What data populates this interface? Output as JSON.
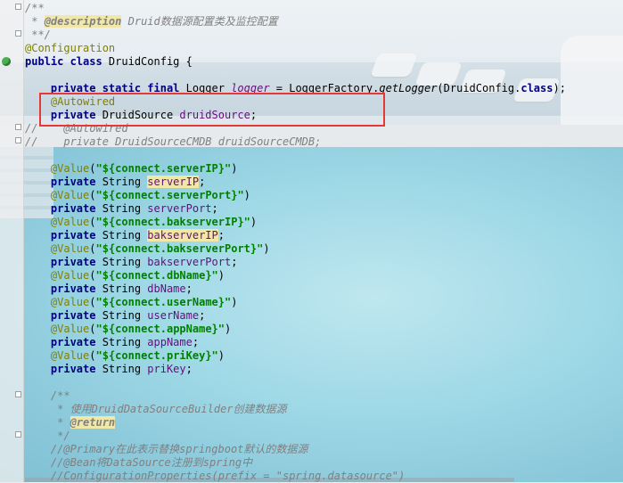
{
  "editor": {
    "lines": [
      [
        {
          "t": "/**",
          "c": "cmt"
        }
      ],
      [
        {
          "t": " * ",
          "c": "cmt"
        },
        {
          "t": "@description",
          "c": "doctag hl"
        },
        {
          "t": " Druid数据源配置类及监控配置",
          "c": "cmt"
        }
      ],
      [
        {
          "t": " **/",
          "c": "cmt"
        }
      ],
      [
        {
          "t": "@Configuration",
          "c": "ann"
        }
      ],
      [
        {
          "t": "public class ",
          "c": "kw"
        },
        {
          "t": "DruidConfig {",
          "c": ""
        }
      ],
      [
        {
          "t": "",
          "c": ""
        }
      ],
      [
        {
          "t": "    "
        },
        {
          "t": "private static final ",
          "c": "kw"
        },
        {
          "t": "Logger ",
          "c": ""
        },
        {
          "t": "logger",
          "c": "fld ital"
        },
        {
          "t": " = LoggerFactory.",
          "c": ""
        },
        {
          "t": "getLogger",
          "c": "ital"
        },
        {
          "t": "(DruidConfig.",
          "c": ""
        },
        {
          "t": "class",
          "c": "kw"
        },
        {
          "t": ");",
          "c": ""
        }
      ],
      [
        {
          "t": "    "
        },
        {
          "t": "@Autowired",
          "c": "ann"
        }
      ],
      [
        {
          "t": "    "
        },
        {
          "t": "private ",
          "c": "kw"
        },
        {
          "t": "DruidSource ",
          "c": ""
        },
        {
          "t": "druidSource",
          "c": "fld"
        },
        {
          "t": ";",
          "c": ""
        }
      ],
      [
        {
          "t": "//    @Autowired",
          "c": "cmt"
        }
      ],
      [
        {
          "t": "//    private DruidSourceCMDB druidSourceCMDB;",
          "c": "cmt"
        }
      ],
      [
        {
          "t": "",
          "c": ""
        }
      ],
      [
        {
          "t": "    "
        },
        {
          "t": "@Value",
          "c": "ann"
        },
        {
          "t": "(",
          "c": ""
        },
        {
          "t": "\"${connect.serverIP}\"",
          "c": "str"
        },
        {
          "t": ")",
          "c": ""
        }
      ],
      [
        {
          "t": "    "
        },
        {
          "t": "private ",
          "c": "kw"
        },
        {
          "t": "String ",
          "c": ""
        },
        {
          "t": "serverIP",
          "c": "fld hl"
        },
        {
          "t": ";",
          "c": ""
        }
      ],
      [
        {
          "t": "    "
        },
        {
          "t": "@Value",
          "c": "ann"
        },
        {
          "t": "(",
          "c": ""
        },
        {
          "t": "\"${connect.serverPort}\"",
          "c": "str"
        },
        {
          "t": ")",
          "c": ""
        }
      ],
      [
        {
          "t": "    "
        },
        {
          "t": "private ",
          "c": "kw"
        },
        {
          "t": "String ",
          "c": ""
        },
        {
          "t": "serverPort",
          "c": "fld"
        },
        {
          "t": ";",
          "c": ""
        }
      ],
      [
        {
          "t": "    "
        },
        {
          "t": "@Value",
          "c": "ann"
        },
        {
          "t": "(",
          "c": ""
        },
        {
          "t": "\"${connect.bakserverIP}\"",
          "c": "str"
        },
        {
          "t": ")",
          "c": ""
        }
      ],
      [
        {
          "t": "    "
        },
        {
          "t": "private ",
          "c": "kw"
        },
        {
          "t": "String ",
          "c": ""
        },
        {
          "t": "bakserverIP",
          "c": "fld hl"
        },
        {
          "t": ";",
          "c": ""
        }
      ],
      [
        {
          "t": "    "
        },
        {
          "t": "@Value",
          "c": "ann"
        },
        {
          "t": "(",
          "c": ""
        },
        {
          "t": "\"${connect.bakserverPort}\"",
          "c": "str"
        },
        {
          "t": ")",
          "c": ""
        }
      ],
      [
        {
          "t": "    "
        },
        {
          "t": "private ",
          "c": "kw"
        },
        {
          "t": "String ",
          "c": ""
        },
        {
          "t": "bakserverPort",
          "c": "fld"
        },
        {
          "t": ";",
          "c": ""
        }
      ],
      [
        {
          "t": "    "
        },
        {
          "t": "@Value",
          "c": "ann"
        },
        {
          "t": "(",
          "c": ""
        },
        {
          "t": "\"${connect.dbName}\"",
          "c": "str"
        },
        {
          "t": ")",
          "c": ""
        }
      ],
      [
        {
          "t": "    "
        },
        {
          "t": "private ",
          "c": "kw"
        },
        {
          "t": "String ",
          "c": ""
        },
        {
          "t": "dbName",
          "c": "fld"
        },
        {
          "t": ";",
          "c": ""
        }
      ],
      [
        {
          "t": "    "
        },
        {
          "t": "@Value",
          "c": "ann"
        },
        {
          "t": "(",
          "c": ""
        },
        {
          "t": "\"${connect.userName}\"",
          "c": "str"
        },
        {
          "t": ")",
          "c": ""
        }
      ],
      [
        {
          "t": "    "
        },
        {
          "t": "private ",
          "c": "kw"
        },
        {
          "t": "String ",
          "c": ""
        },
        {
          "t": "userName",
          "c": "fld"
        },
        {
          "t": ";",
          "c": ""
        }
      ],
      [
        {
          "t": "    "
        },
        {
          "t": "@Value",
          "c": "ann"
        },
        {
          "t": "(",
          "c": ""
        },
        {
          "t": "\"${connect.appName}\"",
          "c": "str"
        },
        {
          "t": ")",
          "c": ""
        }
      ],
      [
        {
          "t": "    "
        },
        {
          "t": "private ",
          "c": "kw"
        },
        {
          "t": "String ",
          "c": ""
        },
        {
          "t": "appName",
          "c": "fld"
        },
        {
          "t": ";",
          "c": ""
        }
      ],
      [
        {
          "t": "    "
        },
        {
          "t": "@Value",
          "c": "ann"
        },
        {
          "t": "(",
          "c": ""
        },
        {
          "t": "\"${connect.priKey}\"",
          "c": "str"
        },
        {
          "t": ")",
          "c": ""
        }
      ],
      [
        {
          "t": "    "
        },
        {
          "t": "private ",
          "c": "kw"
        },
        {
          "t": "String ",
          "c": ""
        },
        {
          "t": "priKey",
          "c": "fld"
        },
        {
          "t": ";",
          "c": ""
        }
      ],
      [
        {
          "t": "",
          "c": ""
        }
      ],
      [
        {
          "t": "    /**",
          "c": "cmt"
        }
      ],
      [
        {
          "t": "     * 使用",
          "c": "cmt"
        },
        {
          "t": "DruidDataSourceBuilder",
          "c": "cmt"
        },
        {
          "t": "创建数据源",
          "c": "cmt"
        }
      ],
      [
        {
          "t": "     * ",
          "c": "cmt"
        },
        {
          "t": "@return",
          "c": "doctag hl"
        }
      ],
      [
        {
          "t": "     */",
          "c": "cmt"
        }
      ],
      [
        {
          "t": "    //@Primary在此表示替换springboot默认的数据源",
          "c": "cmt"
        }
      ],
      [
        {
          "t": "    //@Bean将DataSource注册到spring中",
          "c": "cmt"
        }
      ],
      [
        {
          "t": "    //ConfigurationProperties(prefix = \"spring.datasource\")",
          "c": "cmt"
        }
      ]
    ]
  },
  "annotation": {
    "highlight_color": "#e53935"
  }
}
